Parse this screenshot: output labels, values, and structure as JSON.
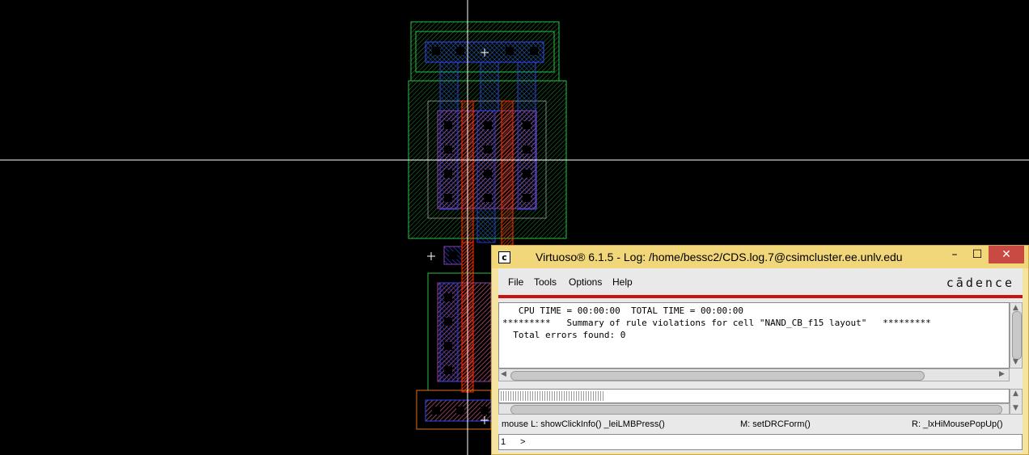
{
  "window": {
    "title": "Virtuoso® 6.1.5 - Log: /home/bessc2/CDS.log.7@csimcluster.ee.unlv.edu",
    "icon": "cadence-c-icon",
    "controls": {
      "minimize": "–",
      "maximize": "☐",
      "close": "✕"
    }
  },
  "menubar": {
    "items": [
      {
        "label": "File"
      },
      {
        "label": "Tools"
      },
      {
        "label": "Options"
      },
      {
        "label": "Help"
      }
    ],
    "brand": "cādence"
  },
  "log": {
    "lines": [
      "   CPU TIME = 00:00:00  TOTAL TIME = 00:00:00",
      "*********   Summary of rule violations for cell \"NAND_CB_f15 layout\"   *********",
      "  Total errors found: 0"
    ]
  },
  "command": {
    "value": ""
  },
  "mouse_bindings": {
    "left": "mouse L: showClickInfo() _leiLMBPress()",
    "middle": "M: setDRCForm()",
    "right": "R: _lxHiMousePopUp()"
  },
  "status": {
    "number": "1",
    "prompt": ">"
  },
  "colors": {
    "title_bar": "#f2d77a",
    "accent_red": "#cc1111",
    "layout_background": "#000000",
    "nwell": "#22cc44",
    "metal1": "#3344ff",
    "poly": "#ff2200",
    "contact": "#000000",
    "diffusion": "#cc6688"
  }
}
